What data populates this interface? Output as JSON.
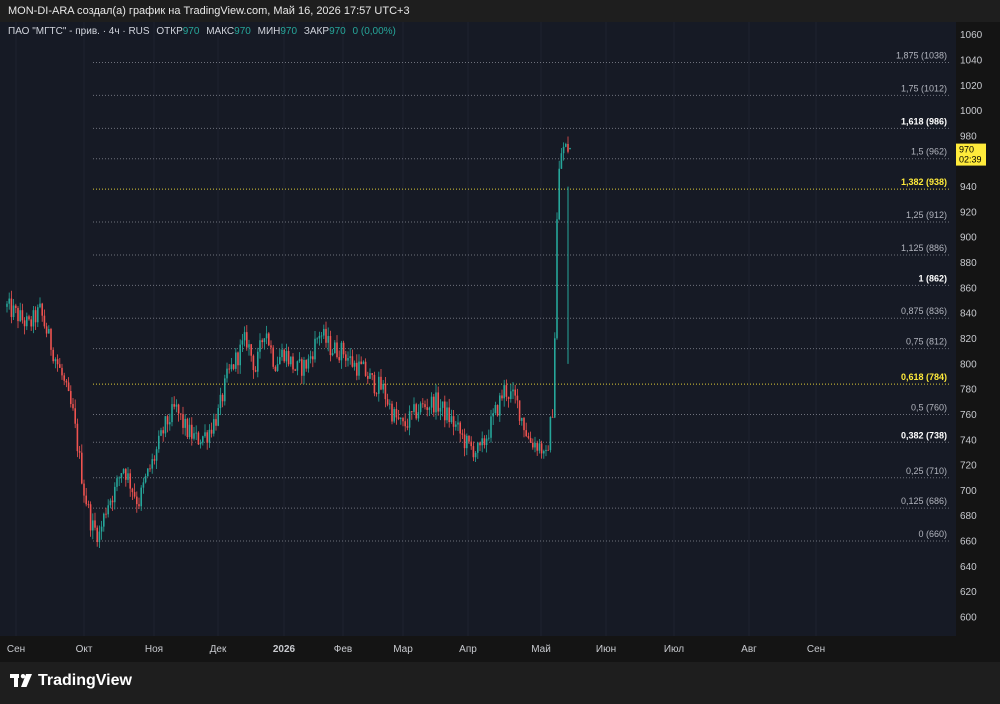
{
  "header": {
    "attribution": "MON-DI-ARA создал(а) график на TradingView.com, Май 16, 2026 17:57 UTC+3"
  },
  "legend": {
    "symbol": "ПАО \"МГТС\" - прив. · 4ч · RUS",
    "open_label": "ОТКР",
    "open": "970",
    "high_label": "МАКС",
    "high": "970",
    "low_label": "МИН",
    "low": "970",
    "close_label": "ЗАКР",
    "close": "970",
    "change": "0 (0,00%)"
  },
  "price_tag": {
    "price": "970",
    "countdown": "02:39"
  },
  "footer": {
    "brand": "TradingView"
  },
  "colors": {
    "up": "#26a69a",
    "down": "#ef5350",
    "background": "#161a25",
    "fib_line": "#787b86",
    "fib_highlight": "#ffeb3b",
    "price_tag": "#ffeb3b"
  },
  "chart_data": {
    "type": "candlestick",
    "ylim": [
      585,
      1070
    ],
    "y_ticks": [
      600,
      620,
      640,
      660,
      680,
      700,
      720,
      740,
      760,
      780,
      800,
      820,
      840,
      860,
      880,
      900,
      920,
      940,
      960,
      980,
      1000,
      1020,
      1040,
      1060
    ],
    "x_labels": [
      "Сен",
      "Окт",
      "Ноя",
      "Дек",
      "2026",
      "Фев",
      "Мар",
      "Апр",
      "Май",
      "Июн",
      "Июл",
      "Авг",
      "Сен"
    ],
    "fibonacci": [
      {
        "level": "1,875",
        "price": 1038,
        "highlight": false,
        "bold": false
      },
      {
        "level": "1,75",
        "price": 1012,
        "highlight": false,
        "bold": false
      },
      {
        "level": "1,618",
        "price": 986,
        "highlight": false,
        "bold": true
      },
      {
        "level": "1,5",
        "price": 962,
        "highlight": false,
        "bold": false
      },
      {
        "level": "1,382",
        "price": 938,
        "highlight": true,
        "bold": true
      },
      {
        "level": "1,25",
        "price": 912,
        "highlight": false,
        "bold": false
      },
      {
        "level": "1,125",
        "price": 886,
        "highlight": false,
        "bold": false
      },
      {
        "level": "1",
        "price": 862,
        "highlight": false,
        "bold": true
      },
      {
        "level": "0,875",
        "price": 836,
        "highlight": false,
        "bold": false
      },
      {
        "level": "0,75",
        "price": 812,
        "highlight": false,
        "bold": false
      },
      {
        "level": "0,618",
        "price": 784,
        "highlight": true,
        "bold": true
      },
      {
        "level": "0,5",
        "price": 760,
        "highlight": false,
        "bold": false
      },
      {
        "level": "0,382",
        "price": 738,
        "highlight": false,
        "bold": true
      },
      {
        "level": "0,25",
        "price": 710,
        "highlight": false,
        "bold": false
      },
      {
        "level": "0,125",
        "price": 686,
        "highlight": false,
        "bold": false
      },
      {
        "level": "0",
        "price": 660,
        "highlight": false,
        "bold": false
      }
    ],
    "price_path": [
      [
        "Сен",
        845
      ],
      [
        "Сен",
        838
      ],
      [
        "Сен",
        830
      ],
      [
        "Сен",
        842
      ],
      [
        "Сен",
        815
      ],
      [
        "Сен",
        790
      ],
      [
        "Сен",
        760
      ],
      [
        "Окт",
        700
      ],
      [
        "Окт",
        672
      ],
      [
        "Окт",
        665
      ],
      [
        "Окт",
        690
      ],
      [
        "Окт",
        700
      ],
      [
        "Окт",
        720
      ],
      [
        "Окт",
        705
      ],
      [
        "Окт",
        690
      ],
      [
        "Окт",
        710
      ],
      [
        "Ноя",
        725
      ],
      [
        "Ноя",
        750
      ],
      [
        "Ноя",
        765
      ],
      [
        "Ноя",
        748
      ],
      [
        "Ноя",
        740
      ],
      [
        "Ноя",
        745
      ],
      [
        "Дек",
        760
      ],
      [
        "Дек",
        790
      ],
      [
        "Дек",
        805
      ],
      [
        "Дек",
        820
      ],
      [
        "Дек",
        795
      ],
      [
        "Дек",
        830
      ],
      [
        "Дек",
        800
      ],
      [
        "2026",
        810
      ],
      [
        "2026",
        795
      ],
      [
        "2026",
        800
      ],
      [
        "2026",
        825
      ],
      [
        "2026",
        812
      ],
      [
        "Фев",
        810
      ],
      [
        "Фев",
        800
      ],
      [
        "Фев",
        795
      ],
      [
        "Фев",
        785
      ],
      [
        "Фев",
        780
      ],
      [
        "Фев",
        760
      ],
      [
        "Мар",
        750
      ],
      [
        "Мар",
        765
      ],
      [
        "Мар",
        770
      ],
      [
        "Мар",
        755
      ],
      [
        "Апр",
        735
      ],
      [
        "Апр",
        730
      ],
      [
        "Апр",
        755
      ],
      [
        "Апр",
        780
      ],
      [
        "Апр",
        770
      ],
      [
        "Апр",
        740
      ],
      [
        "Май",
        735
      ],
      [
        "Май",
        720
      ],
      [
        "Май",
        745
      ],
      [
        "Май",
        770
      ],
      [
        "Май",
        940
      ],
      [
        "Май",
        970
      ]
    ]
  }
}
